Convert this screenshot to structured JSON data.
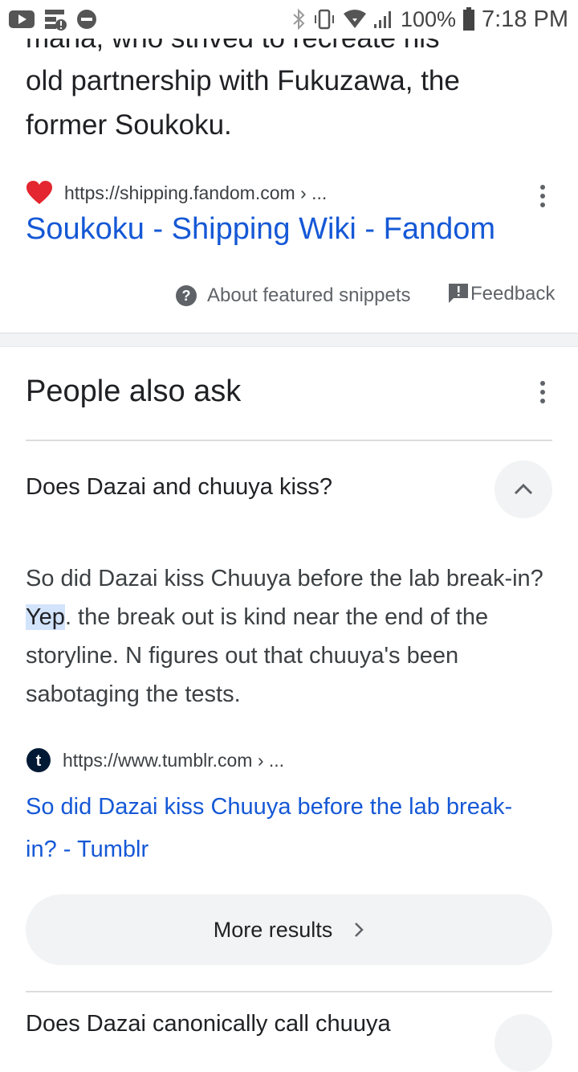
{
  "status_bar": {
    "battery": "100%",
    "time": "7:18 PM"
  },
  "snippet": {
    "cut_line": "mana, who strived to recreate his",
    "line1": "old partnership with Fukuzawa, the",
    "line2": "former Soukoku.",
    "source_url": "https://shipping.fandom.com › ...",
    "link_title": "Soukoku - Shipping Wiki - Fandom",
    "about_label": "About featured snippets",
    "feedback_label": "Feedback"
  },
  "people_also_ask": {
    "title": "People also ask",
    "question1": "Does Dazai and chuuya kiss?",
    "answer_before": "So did Dazai kiss Chuuya before the lab break-in? ",
    "answer_highlight": "Yep",
    "answer_after": ". the break out is kind near the end of the storyline. N figures out that chuuya's been sabotaging the tests.",
    "answer_source_url": "https://www.tumblr.com › ...",
    "answer_link": "So did Dazai kiss Chuuya before the lab break-in? - Tumblr",
    "more_results_label": "More results",
    "question2": "Does Dazai canonically call chuuya"
  },
  "colors": {
    "link": "#1558d6",
    "heart": "#e3262f",
    "highlight": "#d2e3fc"
  }
}
